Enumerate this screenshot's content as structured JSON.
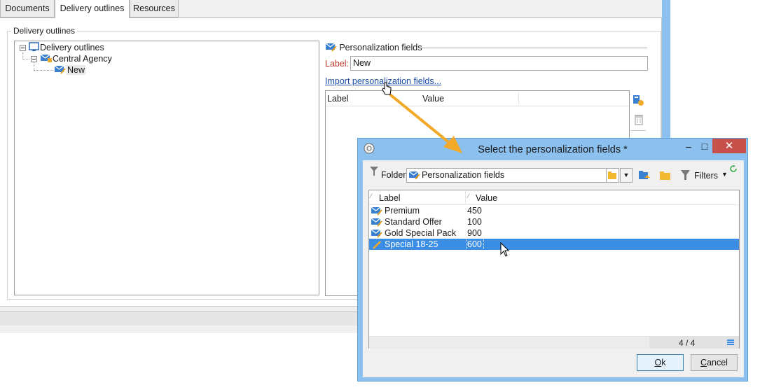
{
  "tabs": [
    "Documents",
    "Delivery outlines",
    "Resources"
  ],
  "group_title": "Delivery outlines",
  "tree": {
    "root": "Delivery outlines",
    "child": "Central Agency",
    "leaf": "New"
  },
  "form": {
    "section_title": "Personalization fields",
    "label_caption": "Label:",
    "label_value": "New",
    "import_link": "Import personalization fields...",
    "grid_headers": [
      "Label",
      "Value"
    ]
  },
  "dialog": {
    "title": "Select the personalization fields *",
    "folder_caption": "Folder:",
    "folder_value": "Personalization fields",
    "filters_label": "Filters",
    "columns": [
      "Label",
      "Value"
    ],
    "rows": [
      {
        "label": "Premium",
        "value": "450",
        "selected": false
      },
      {
        "label": "Standard Offer",
        "value": "100",
        "selected": false
      },
      {
        "label": "Gold Special Pack",
        "value": "900",
        "selected": false
      },
      {
        "label": "Special 18-25",
        "value": "600",
        "selected": true
      }
    ],
    "count": "4 / 4",
    "ok_label": "Ok",
    "cancel_label": "Cancel"
  },
  "colors": {
    "accent": "#3a8ee6",
    "dialog_frame": "#8cc0ee",
    "close_button": "#c7504b",
    "link": "#1a4da8",
    "label_required": "#c0392b",
    "arrow": "#f2a928"
  },
  "icons": [
    "envelope-wrench-icon",
    "folder-icon",
    "filter-icon",
    "refresh-icon",
    "trash-icon",
    "new-field-icon",
    "app-icon",
    "minimize-icon",
    "maximize-icon",
    "close-icon",
    "hand-cursor-icon",
    "arrow-cursor-icon"
  ]
}
